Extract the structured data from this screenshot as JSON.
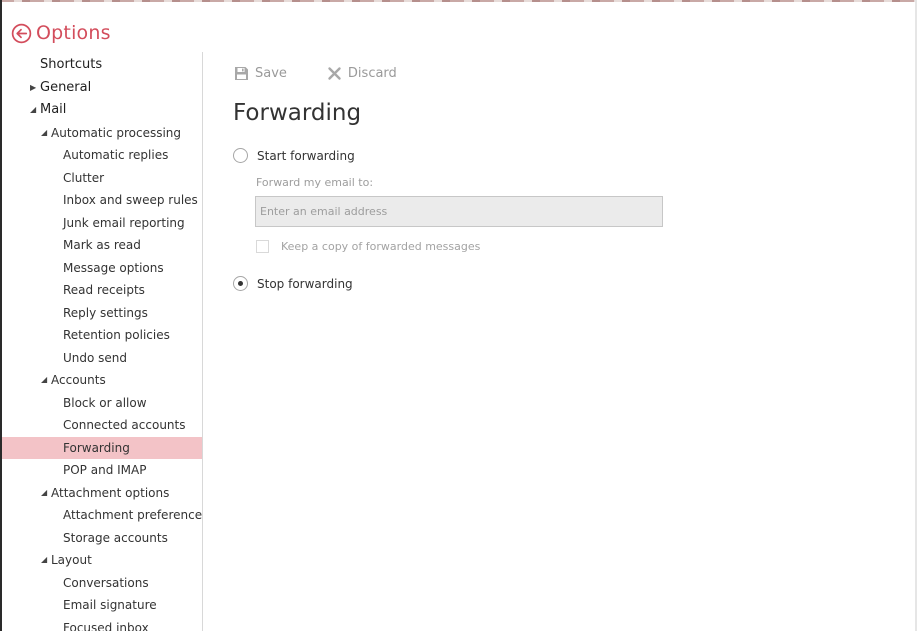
{
  "header": {
    "title": "Options",
    "back_icon": "circle-arrow-left-icon",
    "accent": "#d34d5c"
  },
  "sidebar": {
    "selected_color": "#f3c3c7",
    "items": [
      {
        "label": "Shortcuts",
        "level": 0,
        "caret": ""
      },
      {
        "label": "General",
        "level": 0,
        "caret": "▶"
      },
      {
        "label": "Mail",
        "level": 0,
        "caret": "◢"
      },
      {
        "label": "Automatic processing",
        "level": 1,
        "caret": "◢"
      },
      {
        "label": "Automatic replies",
        "level": 2,
        "caret": ""
      },
      {
        "label": "Clutter",
        "level": 2,
        "caret": ""
      },
      {
        "label": "Inbox and sweep rules",
        "level": 2,
        "caret": ""
      },
      {
        "label": "Junk email reporting",
        "level": 2,
        "caret": ""
      },
      {
        "label": "Mark as read",
        "level": 2,
        "caret": ""
      },
      {
        "label": "Message options",
        "level": 2,
        "caret": ""
      },
      {
        "label": "Read receipts",
        "level": 2,
        "caret": ""
      },
      {
        "label": "Reply settings",
        "level": 2,
        "caret": ""
      },
      {
        "label": "Retention policies",
        "level": 2,
        "caret": ""
      },
      {
        "label": "Undo send",
        "level": 2,
        "caret": ""
      },
      {
        "label": "Accounts",
        "level": 1,
        "caret": "◢"
      },
      {
        "label": "Block or allow",
        "level": 2,
        "caret": ""
      },
      {
        "label": "Connected accounts",
        "level": 2,
        "caret": ""
      },
      {
        "label": "Forwarding",
        "level": 2,
        "caret": "",
        "selected": true
      },
      {
        "label": "POP and IMAP",
        "level": 2,
        "caret": ""
      },
      {
        "label": "Attachment options",
        "level": 1,
        "caret": "◢"
      },
      {
        "label": "Attachment preferences",
        "level": 2,
        "caret": ""
      },
      {
        "label": "Storage accounts",
        "level": 2,
        "caret": ""
      },
      {
        "label": "Layout",
        "level": 1,
        "caret": "◢"
      },
      {
        "label": "Conversations",
        "level": 2,
        "caret": ""
      },
      {
        "label": "Email signature",
        "level": 2,
        "caret": ""
      },
      {
        "label": "Focused inbox",
        "level": 2,
        "caret": ""
      }
    ]
  },
  "toolbar": {
    "save_label": "Save",
    "save_icon": "floppy-disk-icon",
    "discard_label": "Discard",
    "discard_icon": "x-icon"
  },
  "main": {
    "title": "Forwarding",
    "start_forwarding": {
      "label": "Start forwarding",
      "checked": false
    },
    "forward_to_label": "Forward my email to:",
    "email_input": {
      "value": "",
      "placeholder": "Enter an email address"
    },
    "keep_copy": {
      "label": "Keep a copy of forwarded messages",
      "checked": false
    },
    "stop_forwarding": {
      "label": "Stop forwarding",
      "checked": true
    }
  }
}
